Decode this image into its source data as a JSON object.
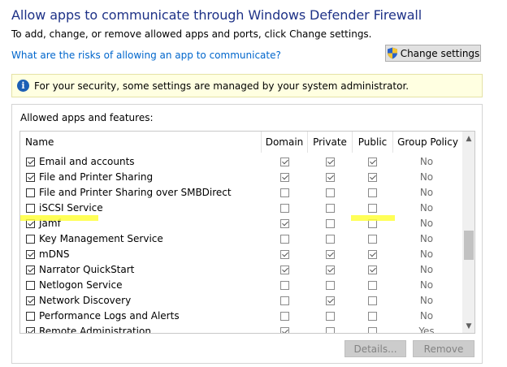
{
  "header": {
    "title": "Allow apps to communicate through Windows Defender Firewall",
    "subtitle": "To add, change, or remove allowed apps and ports, click Change settings.",
    "risk_link": "What are the risks of allowing an app to communicate?",
    "change_settings": "Change settings"
  },
  "info_bar": {
    "text": "For your security, some settings are managed by your system administrator.",
    "icon": "i"
  },
  "group": {
    "label": "Allowed apps and features:"
  },
  "columns": {
    "name": "Name",
    "domain": "Domain",
    "private": "Private",
    "public": "Public",
    "group_policy": "Group Policy"
  },
  "rows": [
    {
      "name": "Email and accounts",
      "enabled": true,
      "domain": true,
      "private": true,
      "public": true,
      "gp": "No"
    },
    {
      "name": "File and Printer Sharing",
      "enabled": true,
      "domain": true,
      "private": true,
      "public": true,
      "gp": "No"
    },
    {
      "name": "File and Printer Sharing over SMBDirect",
      "enabled": false,
      "domain": false,
      "private": false,
      "public": false,
      "gp": "No"
    },
    {
      "name": "iSCSI Service",
      "enabled": false,
      "domain": false,
      "private": false,
      "public": false,
      "gp": "No"
    },
    {
      "name": "Jamf",
      "enabled": true,
      "domain": true,
      "private": false,
      "public": false,
      "gp": "No"
    },
    {
      "name": "Key Management Service",
      "enabled": false,
      "domain": false,
      "private": false,
      "public": false,
      "gp": "No"
    },
    {
      "name": "mDNS",
      "enabled": true,
      "domain": true,
      "private": true,
      "public": true,
      "gp": "No"
    },
    {
      "name": "Narrator QuickStart",
      "enabled": true,
      "domain": true,
      "private": true,
      "public": true,
      "gp": "No"
    },
    {
      "name": "Netlogon Service",
      "enabled": false,
      "domain": false,
      "private": false,
      "public": false,
      "gp": "No"
    },
    {
      "name": "Network Discovery",
      "enabled": true,
      "domain": false,
      "private": true,
      "public": false,
      "gp": "No"
    },
    {
      "name": "Performance Logs and Alerts",
      "enabled": false,
      "domain": false,
      "private": false,
      "public": false,
      "gp": "No"
    },
    {
      "name": "Remote Administration",
      "enabled": true,
      "domain": true,
      "private": false,
      "public": false,
      "gp": "Yes"
    }
  ],
  "buttons": {
    "details": "Details...",
    "remove": "Remove"
  },
  "colors": {
    "title": "#1e3287",
    "link": "#0066cc",
    "info_bg": "#ffffe1",
    "highlight": "#ffff3a"
  }
}
